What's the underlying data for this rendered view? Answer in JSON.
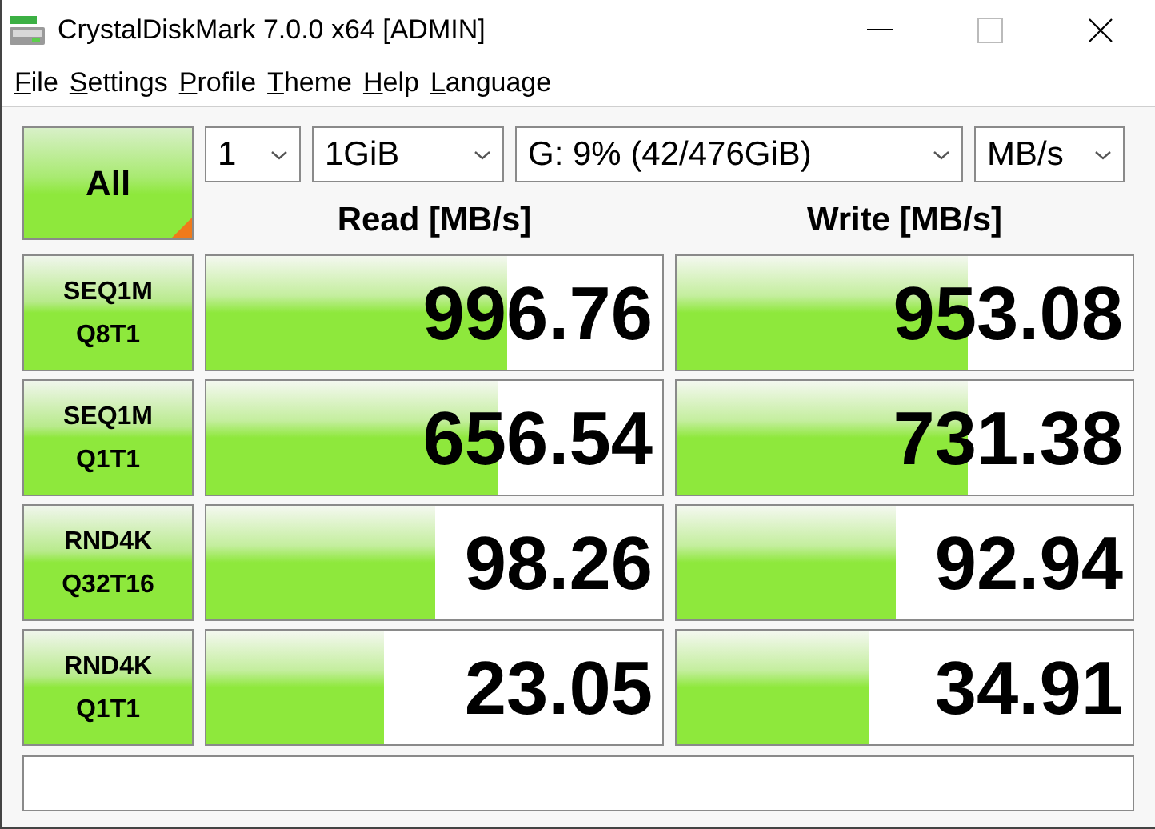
{
  "window": {
    "title": "CrystalDiskMark 7.0.0 x64 [ADMIN]"
  },
  "menu": [
    "File",
    "Settings",
    "Profile",
    "Theme",
    "Help",
    "Language"
  ],
  "all_button": {
    "label": "All"
  },
  "selects": [
    {
      "kind": "count",
      "value": "1"
    },
    {
      "kind": "size",
      "value": "1GiB"
    },
    {
      "kind": "drive",
      "value": "G: 9% (42/476GiB)"
    },
    {
      "kind": "unit",
      "value": "MB/s"
    }
  ],
  "headers": {
    "read": "Read [MB/s]",
    "write": "Write [MB/s]"
  },
  "tests": [
    {
      "line1": "SEQ1M",
      "line2": "Q8T1",
      "read": {
        "value": "996.76",
        "level": 0.66
      },
      "write": {
        "value": "953.08",
        "level": 0.64
      }
    },
    {
      "line1": "SEQ1M",
      "line2": "Q1T1",
      "read": {
        "value": "656.54",
        "level": 0.64
      },
      "write": {
        "value": "731.38",
        "level": 0.64
      }
    },
    {
      "line1": "RND4K",
      "line2": "Q32T16",
      "read": {
        "value": "98.26",
        "level": 0.5
      },
      "write": {
        "value": "92.94",
        "level": 0.48
      }
    },
    {
      "line1": "RND4K",
      "line2": "Q1T1",
      "read": {
        "value": "23.05",
        "level": 0.39
      },
      "write": {
        "value": "34.91",
        "level": 0.42
      }
    }
  ]
}
